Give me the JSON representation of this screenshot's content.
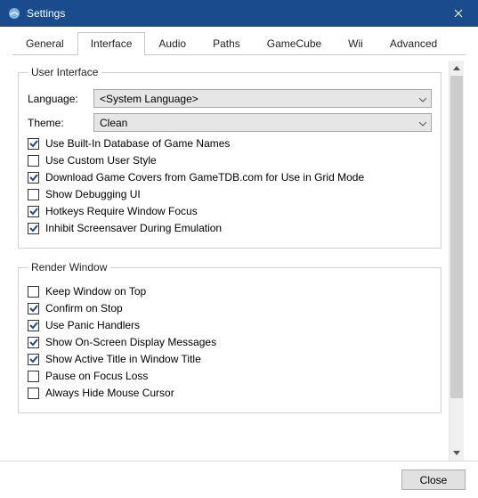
{
  "window": {
    "title": "Settings"
  },
  "tabs": [
    "General",
    "Interface",
    "Audio",
    "Paths",
    "GameCube",
    "Wii",
    "Advanced"
  ],
  "active_tab_index": 1,
  "groups": {
    "ui": {
      "legend": "User Interface",
      "language_label": "Language:",
      "language_value": "<System Language>",
      "theme_label": "Theme:",
      "theme_value": "Clean",
      "checks": [
        {
          "label": "Use Built-In Database of Game Names",
          "checked": true
        },
        {
          "label": "Use Custom User Style",
          "checked": false
        },
        {
          "label": "Download Game Covers from GameTDB.com for Use in Grid Mode",
          "checked": true
        },
        {
          "label": "Show Debugging UI",
          "checked": false
        },
        {
          "label": "Hotkeys Require Window Focus",
          "checked": true
        },
        {
          "label": "Inhibit Screensaver During Emulation",
          "checked": true
        }
      ]
    },
    "render": {
      "legend": "Render Window",
      "checks": [
        {
          "label": "Keep Window on Top",
          "checked": false
        },
        {
          "label": "Confirm on Stop",
          "checked": true
        },
        {
          "label": "Use Panic Handlers",
          "checked": true
        },
        {
          "label": "Show On-Screen Display Messages",
          "checked": true
        },
        {
          "label": "Show Active Title in Window Title",
          "checked": true
        },
        {
          "label": "Pause on Focus Loss",
          "checked": false
        },
        {
          "label": "Always Hide Mouse Cursor",
          "checked": false
        }
      ]
    }
  },
  "footer": {
    "close": "Close"
  }
}
